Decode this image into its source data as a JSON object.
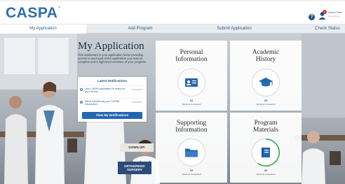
{
  "brand": {
    "logo_text": "CASPA",
    "trademark": "™",
    "colors": {
      "brand_blue": "#2f6fa9",
      "button_blue": "#2466b0",
      "nav_bg": "#e9ecef"
    }
  },
  "header": {
    "help_icon": "question-circle-icon",
    "help_glyph": "?",
    "user_icon": "user-avatar-icon",
    "notification_count": "1",
    "user_name": "Jessica Taher",
    "user_sub": "cas.xxxxxxxx"
  },
  "nav": {
    "tabs": [
      {
        "label": "My Application",
        "active": true
      },
      {
        "label": "Add Program",
        "active": false
      },
      {
        "label": "Submit Application",
        "active": false
      },
      {
        "label": "Check Status",
        "active": false
      }
    ]
  },
  "main": {
    "title": "My Application",
    "intro": "This dashboard is your application home providing access to each part of the application you need to complete and a high-level overview of your progress.",
    "notifications": {
      "title": "Latest Notifications",
      "items": [
        {
          "icon": "clock-icon",
          "text": "Your CASPA application is ready for your review.",
          "date": "00/00/0000"
        },
        {
          "icon": "clock-icon",
          "text": "We're transferring your CASPA information.",
          "date": "00/00/0000"
        }
      ],
      "button_label": "View My Notifications"
    },
    "background_signs": {
      "sign_1": "GOWN UP!",
      "sign_2": "ORTHOPEDIC SURGERY"
    }
  },
  "cards": [
    {
      "title_line1": "Personal",
      "title_line2": "Information",
      "icon": "id-card-icon",
      "count": "0/0",
      "status": "Sections Completed",
      "progress": 0
    },
    {
      "title_line1": "Academic",
      "title_line2": "History",
      "icon": "graduation-cap-icon",
      "count": "0/0",
      "status": "Sections Completed",
      "progress": 0
    },
    {
      "title_line1": "Supporting",
      "title_line2": "Information",
      "icon": "folder-icon",
      "count": "0/0",
      "status": "Sections Completed",
      "progress": 0
    },
    {
      "title_line1": "Program",
      "title_line2": "Materials",
      "icon": "book-icon",
      "count": "0/0",
      "status": "Sections Completed",
      "progress": 0.6
    }
  ]
}
